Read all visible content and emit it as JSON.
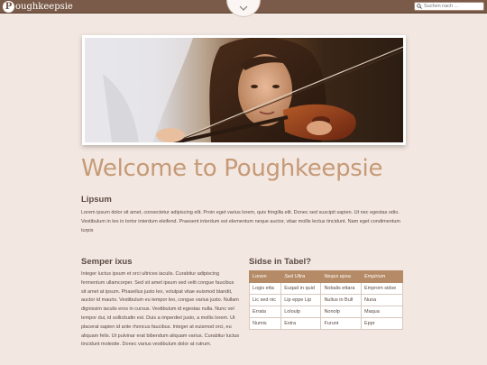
{
  "header": {
    "logo_letter": "P",
    "logo_text": "oughkeepsie",
    "search_placeholder": "Suchen nach ..."
  },
  "hero": {
    "image": "girl-playing-violin-photo"
  },
  "main": {
    "title": "Welcome to Poughkeepsie",
    "lipsum": {
      "title": "Lipsum",
      "text": "Lorem ipsum dolor sit amet, consectetur adipiscing elit. Proin eget varius lorem, quis fringilla elit. Donec sed suscipit sapien. Ut nec egestas odio. Vestibulum in leo in tortor interdum eleifend. Praesent interdum est elementum neque auctor, vitae mollis lectus tincidunt. Nam eget condimentum turpis"
    },
    "semper": {
      "title": "Semper ixus",
      "text": "Integer luctus ipsum et orci ultrices iaculis. Curabitur adipiscing fermentum ullamcorper. Sed sit amet ipsum sed velit congue faucibus sit amet at ipsum. Phasellus justo leo, volutpat vitae euismod blandit, auctor id mauris. Vestibulum eu tempor leo, congue varius justo. Nullam dignissim iaculis eros in cursus. Vestibulum id egestas nulla. Nunc vel tempor dui, id sollicitudin est. Duis a imperdiet justo, a mollis lorem. Ut placerat sapien id ante rhoncus faucibus. Integer at euismod orci, eu aliquam felis. Ut pulvinar erat bibendum aliquam varius. Curabitur luctus tincidunt molestie. Donec varius vestibulum dolor at rutrum."
    },
    "sidse": {
      "title": "Sidse in Tabel?",
      "columns": [
        "Lorem",
        "Sed Ultra",
        "Nequs epsa",
        "Empirium"
      ],
      "rows": [
        [
          "Logis etta",
          "Euqad in quid",
          "Nobalis ettara",
          "Emprom sidse"
        ],
        [
          "Lic sed nic",
          "Lip eppe Lip",
          "Nullus in Bull",
          "Nuna"
        ],
        [
          "Errata",
          "Loloulp",
          "Nonolp",
          "Maqua"
        ],
        [
          "Numis",
          "Extra",
          "Furunt",
          "Eppr"
        ]
      ]
    }
  },
  "colors": {
    "topbar": "#7a5a48",
    "background": "#f3e7e1",
    "accent_heading": "#c59a77",
    "table_header": "#b58a66"
  }
}
